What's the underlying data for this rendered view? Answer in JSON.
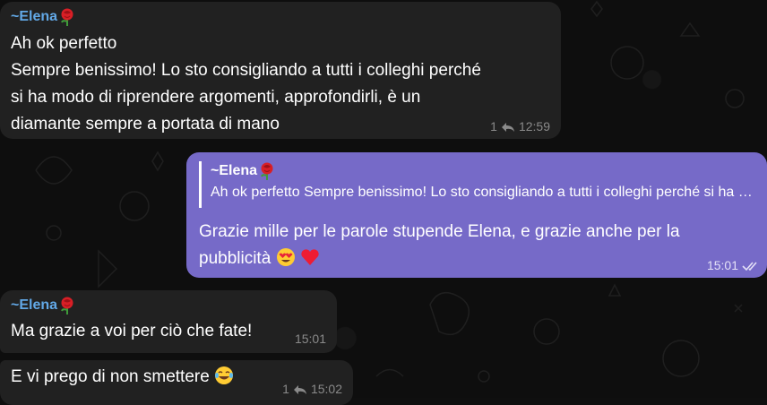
{
  "colors": {
    "background": "#0e0e0e",
    "incoming_bubble": "#212121",
    "outgoing_bubble": "#766ac8",
    "sender_name": "#62a8e6",
    "meta_text": "#8a8a8a"
  },
  "messages": [
    {
      "sender": "~Elena",
      "sender_icon": "rose-icon",
      "text": "Ah ok perfetto\nSempre benissimo! Lo sto consigliando a tutti i colleghi perché\nsi ha modo di riprendere argomenti, approfondirli, è un\ndiamante sempre a portata di mano",
      "reply_count": "1",
      "time": "12:59"
    },
    {
      "outgoing": true,
      "quote_sender": "~Elena",
      "quote_text": "Ah ok perfetto Sempre benissimo! Lo sto consigliando a tutti i colleghi perché si ha modo di riprendere argomenti, approfondirli, è un diamante sempre a portata di mano",
      "text_line1": "Grazie mille per le parole stupende Elena, e grazie anche per la",
      "text_line2": "pubblicità",
      "emojis": [
        "heart-eyes-emoji",
        "red-heart-emoji"
      ],
      "time": "15:01",
      "status_icon": "double-check-icon"
    },
    {
      "sender": "~Elena",
      "sender_icon": "rose-icon",
      "text": "Ma grazie a voi per ciò che fate!",
      "time": "15:01"
    },
    {
      "text": "E vi prego di non smettere",
      "emoji": "joy-emoji",
      "reply_count": "1",
      "time": "15:02"
    }
  ]
}
